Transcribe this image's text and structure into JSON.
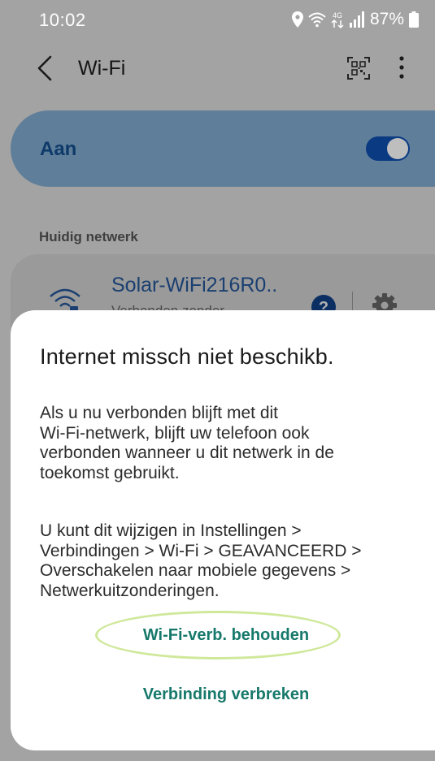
{
  "status_bar": {
    "time": "10:02",
    "battery_text": "87%",
    "icons": [
      "location-icon",
      "wifi-signal-icon",
      "4g-data-icon",
      "cell-signal-icon",
      "battery-icon"
    ]
  },
  "app_bar": {
    "title": "Wi-Fi",
    "icons": [
      "back-icon",
      "qr-code-icon",
      "more-options-icon"
    ]
  },
  "toggle": {
    "label": "Aan",
    "state": true
  },
  "current_network": {
    "section_header": "Huidig netwerk",
    "name": "Solar-WiFi216R0..",
    "status": "Verbonden zonder",
    "icons": [
      "wifi-lock-icon",
      "help-icon",
      "settings-gear-icon"
    ]
  },
  "dialog": {
    "title": "Internet missch niet beschikb.",
    "body_1": "Als u nu verbonden blijft met dit\nWi-Fi-netwerk, blijft uw telefoon ook\nverbonden wanneer u dit netwerk in de\ntoekomst gebruikt.",
    "body_2": "U kunt dit wijzigen in Instellingen >\nVerbindingen > Wi-Fi > GEAVANCEERD >\nOverschakelen naar mobiele gegevens >\nNetwerkuitzonderingen.",
    "keep_button": "Wi-Fi-verb. behouden",
    "disconnect_button": "Verbinding verbreken"
  },
  "colors": {
    "dim_background": "#a3a3a3",
    "toggle_card": "#5f7e9a",
    "accent_teal": "#17796b",
    "highlight": "#cfe89a"
  }
}
